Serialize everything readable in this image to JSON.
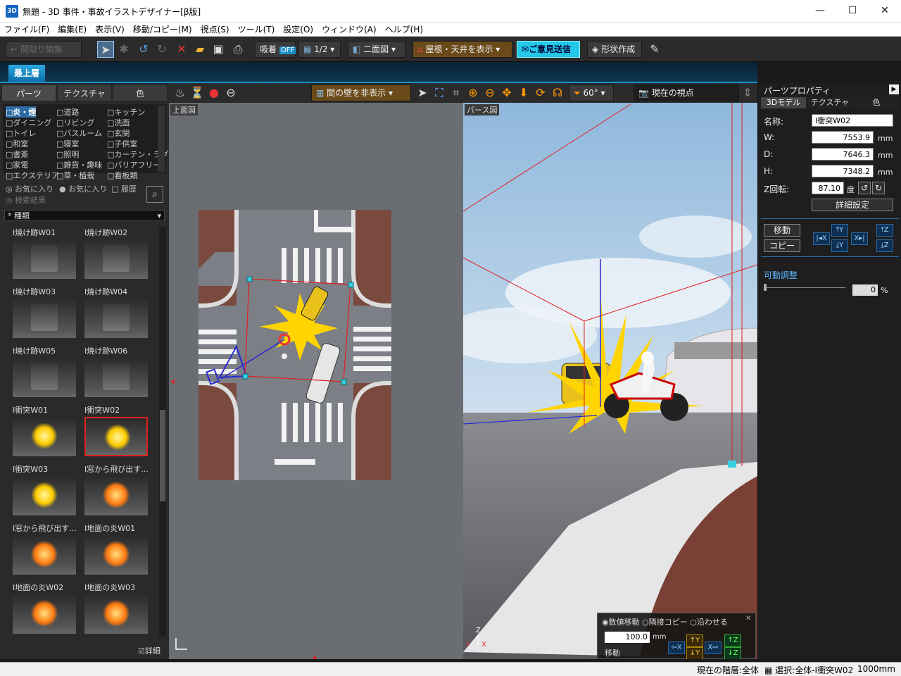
{
  "window": {
    "title": "無題 - 3D 事件・事故イラストデザイナー[β版]",
    "app_icon": "3D"
  },
  "menu": [
    "ファイル(F)",
    "編集(E)",
    "表示(V)",
    "移動/コピー(M)",
    "視点(S)",
    "ツール(T)",
    "設定(O)",
    "ウィンドウ(A)",
    "ヘルプ(H)"
  ],
  "toolbar": {
    "interval_edit": "間取り編集",
    "snap_label": "吸着",
    "snap_state": "OFF",
    "grid_label": "1/2",
    "layout_label": "二面図",
    "roof_label": "屋根・天井を表示",
    "feedback_label": "ご意見送信",
    "shape_label": "形状作成"
  },
  "floor_tab": "最上層",
  "left_panel": {
    "tabs": [
      "パーツ",
      "テクスチャ",
      "色"
    ],
    "categories": [
      [
        "炎・煙",
        "ダイニング",
        "トイレ",
        "和室",
        "書斎",
        "家電",
        "エクステリア"
      ],
      [
        "道路",
        "リビング",
        "バスルーム",
        "寝室",
        "照明",
        "雑貨・趣味",
        "草・植栽"
      ],
      [
        "キッチン",
        "洗面",
        "玄関",
        "子供室",
        "カーテン・ラグ",
        "バリアフリー",
        "看板類"
      ]
    ],
    "favorites": [
      "お気に入り",
      "お気に入り",
      "履歴"
    ],
    "search_result": "検索結果",
    "kind_label": "* 種類",
    "items": [
      "I焼け跡W01",
      "I焼け跡W02",
      "I焼け跡W03",
      "I焼け跡W04",
      "I焼け跡W05",
      "I焼け跡W06",
      "I衝突W01",
      "I衝突W02",
      "I衝突W03",
      "I窓から飛び出す...",
      "I窓から飛び出す...",
      "I地面の炎W01",
      "I地面の炎W02",
      "I地面の炎W03"
    ],
    "detail_label": "詳細"
  },
  "topview": {
    "label": "上面図"
  },
  "view_toolbar": {
    "wall_label": "間の壁を非表示",
    "angle": "60°",
    "viewpoint": "現在の視点"
  },
  "perspview": {
    "label": "パース図"
  },
  "num_move": {
    "options": [
      "数値移動",
      "隣接コピー",
      "沿わせる"
    ],
    "value": "100.0",
    "unit": "mm",
    "move_label": "移動"
  },
  "right_panel": {
    "title": "パーツプロパティ",
    "tabs": [
      "3Dモデル",
      "テクスチャ",
      "色"
    ],
    "name_label": "名称:",
    "name_value": "I衝突W02",
    "w_label": "W:",
    "w_value": "7553.9",
    "d_label": "D:",
    "d_value": "7646.3",
    "h_label": "H:",
    "h_value": "7348.2",
    "unit_mm": "mm",
    "z_label": "Z回転:",
    "z_value": "87.10",
    "z_unit": "度",
    "detail_button": "詳細設定",
    "move_button": "移動",
    "copy_button": "コピー",
    "movable_label": "可動調整",
    "movable_value": "0",
    "movable_unit": "%"
  },
  "status": {
    "floor": "現在の階層:全体",
    "selection": "選択:全体-I衝突W02",
    "grid": "1000mm"
  },
  "colors": {
    "accent": "#1e90c8",
    "selection": "#e02020",
    "flash": "#ffd400"
  }
}
